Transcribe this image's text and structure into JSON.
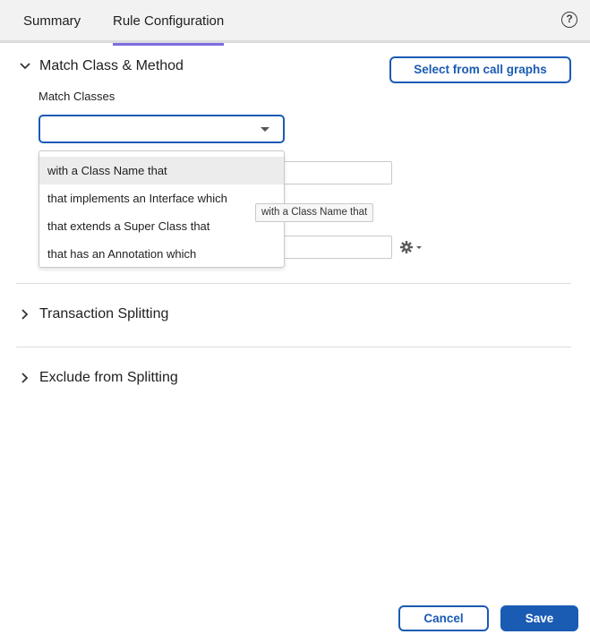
{
  "tabs": {
    "summary": "Summary",
    "rule_configuration": "Rule Configuration",
    "active": "Rule Configuration"
  },
  "help": {
    "glyph": "?"
  },
  "match_section": {
    "title": "Match Class & Method",
    "expanded": true,
    "select_button": "Select from call graphs",
    "match_classes_label": "Match Classes",
    "match_classes_value": "",
    "dropdown_options": [
      "with a Class Name that",
      "that implements an Interface which",
      "that extends a Super Class that",
      "that has an Annotation which"
    ],
    "hovered_option": "with a Class Name that",
    "tooltip": "with a Class Name that",
    "gear_icon": "gear-icon"
  },
  "transaction_splitting": {
    "title": "Transaction Splitting",
    "expanded": false
  },
  "exclude_splitting": {
    "title": "Exclude from Splitting",
    "expanded": false
  },
  "footer": {
    "cancel": "Cancel",
    "save": "Save"
  },
  "colors": {
    "accent": "#1a5bb4",
    "tab_underline": "#7b6ce0"
  }
}
